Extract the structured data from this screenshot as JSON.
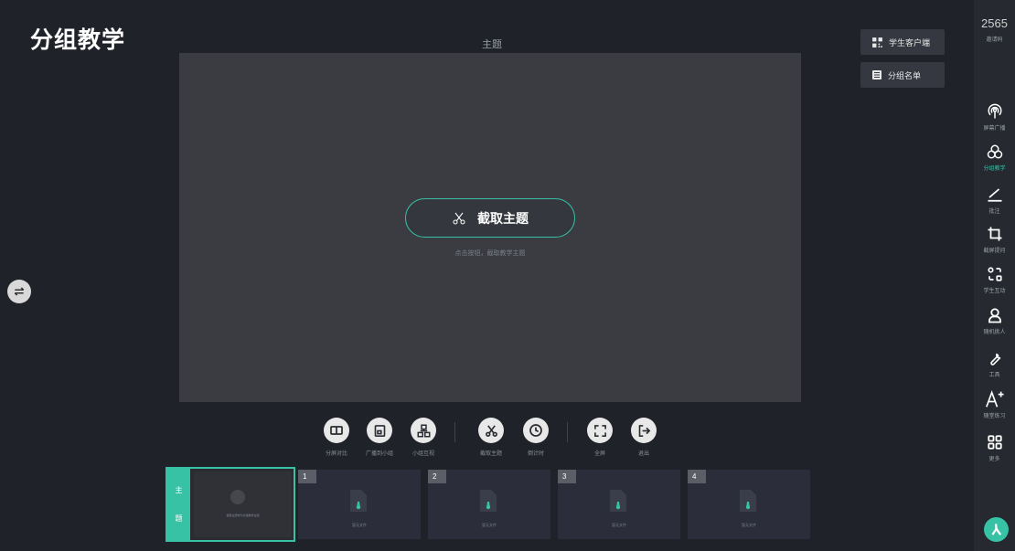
{
  "app_title": "分组教学",
  "topic_label": "主题",
  "capture_button": {
    "label": "截取主题",
    "icon": "scissors-icon"
  },
  "capture_hint": "点击按钮，截取教学主题",
  "top_buttons": [
    {
      "label": "学生客户端",
      "icon": "qr-code-icon"
    },
    {
      "label": "分组名单",
      "icon": "list-icon"
    }
  ],
  "sidebar": {
    "invite_code": "2565",
    "invite_label": "邀请码",
    "items": [
      {
        "label": "屏幕广播",
        "icon": "broadcast-icon"
      },
      {
        "label": "分组教学",
        "icon": "group-icon",
        "active": true
      },
      {
        "label": "批注",
        "icon": "pen-icon"
      },
      {
        "label": "截屏提问",
        "icon": "crop-icon"
      },
      {
        "label": "学生互动",
        "icon": "interaction-icon"
      },
      {
        "label": "随机挑人",
        "icon": "person-icon"
      },
      {
        "label": "工具",
        "icon": "wrench-icon"
      },
      {
        "label": "随堂练习",
        "icon": "font-plus-icon"
      },
      {
        "label": "更多",
        "icon": "grid-icon"
      }
    ]
  },
  "toolbar": [
    {
      "label": "分屏对比",
      "icon": "split-screen-icon"
    },
    {
      "label": "广播到小组",
      "icon": "broadcast-group-icon"
    },
    {
      "label": "小组互视",
      "icon": "group-view-icon"
    },
    {
      "label": "截取主题",
      "icon": "scissors-icon"
    },
    {
      "label": "倒计时",
      "icon": "clock-icon"
    },
    {
      "label": "全屏",
      "icon": "fullscreen-icon"
    },
    {
      "label": "退出",
      "icon": "exit-icon"
    }
  ],
  "topic_thumb": {
    "side_chars": [
      "主",
      "题"
    ],
    "caption": "截取主题作为分组教学主题"
  },
  "groups": [
    {
      "number": "1",
      "label": "暂无文件"
    },
    {
      "number": "2",
      "label": "暂无文件"
    },
    {
      "number": "3",
      "label": "暂无文件"
    },
    {
      "number": "4",
      "label": "暂无文件"
    }
  ],
  "colors": {
    "accent": "#37c2a6",
    "background": "#1f2229",
    "canvas": "#3a3c42"
  }
}
